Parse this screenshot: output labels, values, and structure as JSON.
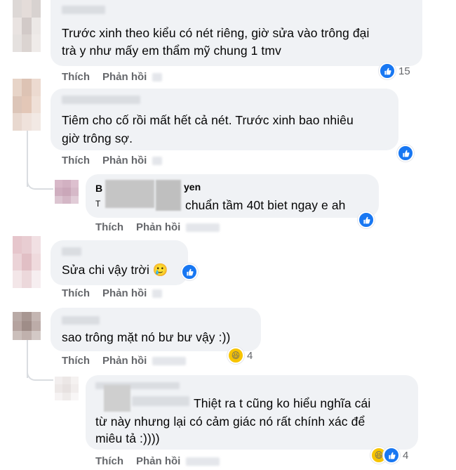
{
  "comments": [
    {
      "name_partial": "",
      "lines": [
        "Trước xinh theo kiểu có nét riêng, giờ sửa vào trông đại",
        "trà y như mấy em thẩm mỹ chung 1 tmv"
      ],
      "like_label": "Thích",
      "reply_label": "Phản hồi",
      "reaction_count": "15"
    },
    {
      "name_partial": "",
      "lines": [
        "Tiêm cho cố rồi mất hết cả nét. Trước xinh bao nhiêu",
        "giờ trông sợ."
      ],
      "like_label": "Thích",
      "reply_label": "Phản hồi",
      "reaction_count": ""
    },
    {
      "name_prefix": "B",
      "name_suffix": "yen",
      "text_tail": "chuẩn tầm 40t biet ngay e ah",
      "text_prefix": "T",
      "like_label": "Thích",
      "reply_label": "Phản hồi",
      "reaction_count": ""
    },
    {
      "name_partial": "",
      "text": "Sửa chi vậy trời 🥲",
      "like_label": "Thích",
      "reply_label": "Phản hồi",
      "reaction_count": ""
    },
    {
      "name_partial": "",
      "text": "sao trông mặt nó bư bư vậy :))",
      "like_label": "Thích",
      "reply_label": "Phản hồi",
      "reaction_count": "4"
    },
    {
      "text_tail": "Thiệt ra t cũng ko hiểu nghĩa cái",
      "lines": [
        "từ này nhưng lại có cảm giác nó rất chính xác để",
        "miêu tả :))))"
      ],
      "like_label": "Thích",
      "reply_label": "Phản hồi",
      "reaction_count": "4"
    }
  ],
  "icons": {
    "like": "like-reaction-icon",
    "haha": "haha-reaction-icon"
  },
  "colors": {
    "bubble": "#f0f2f5",
    "like_blue": "#1877f2",
    "action_gray": "#65676b"
  }
}
